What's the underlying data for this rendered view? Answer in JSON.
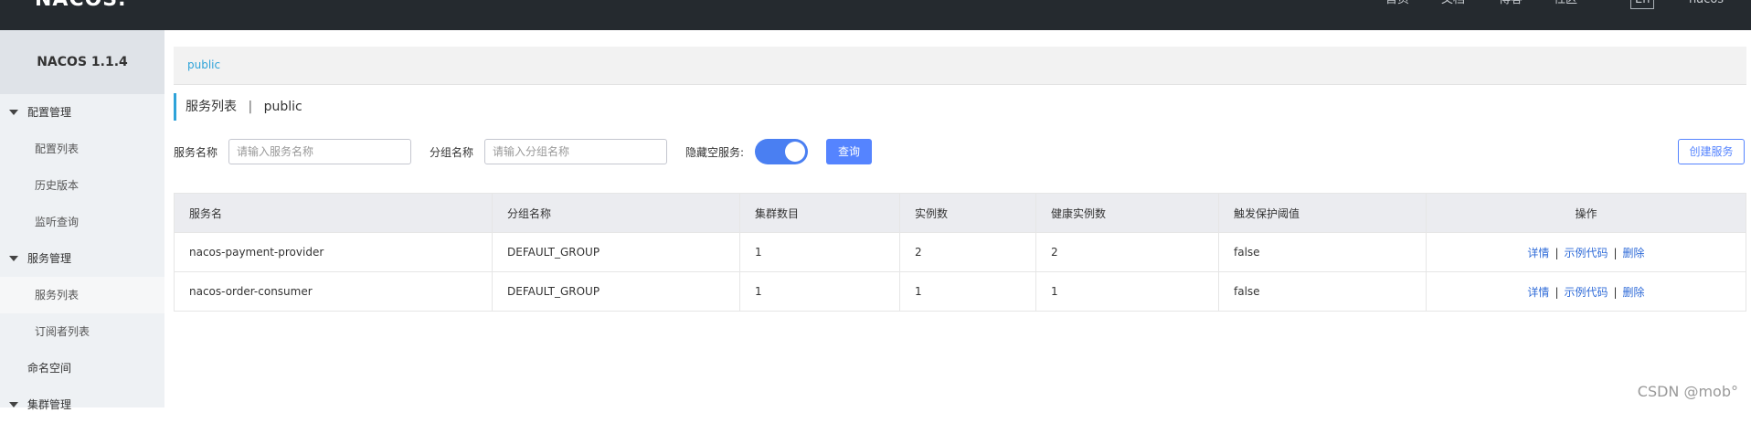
{
  "topbar": {
    "logo": "NACOS.",
    "nav": [
      "首页",
      "文档",
      "博客",
      "社区"
    ],
    "lang": "En",
    "user": "nacos"
  },
  "sidebar": {
    "title": "NACOS 1.1.4",
    "items": [
      {
        "label": "配置管理",
        "type": "group"
      },
      {
        "label": "配置列表",
        "type": "sub"
      },
      {
        "label": "历史版本",
        "type": "sub"
      },
      {
        "label": "监听查询",
        "type": "sub"
      },
      {
        "label": "服务管理",
        "type": "group"
      },
      {
        "label": "服务列表",
        "type": "sub",
        "active": true
      },
      {
        "label": "订阅者列表",
        "type": "sub"
      },
      {
        "label": "命名空间",
        "type": "plain"
      },
      {
        "label": "集群管理",
        "type": "group"
      }
    ]
  },
  "breadcrumb": {
    "namespace": "public"
  },
  "page": {
    "title": "服务列表",
    "separator": "|",
    "namespace": "public"
  },
  "filters": {
    "service_name_label": "服务名称",
    "service_name_placeholder": "请输入服务名称",
    "group_name_label": "分组名称",
    "group_name_placeholder": "请输入分组名称",
    "hide_empty_label": "隐藏空服务:",
    "hide_empty_on": true,
    "query_label": "查询",
    "create_label": "创建服务"
  },
  "table": {
    "headers": [
      "服务名",
      "分组名称",
      "集群数目",
      "实例数",
      "健康实例数",
      "触发保护阈值",
      "操作"
    ],
    "rows": [
      [
        "nacos-payment-provider",
        "DEFAULT_GROUP",
        "1",
        "2",
        "2",
        "false"
      ],
      [
        "nacos-order-consumer",
        "DEFAULT_GROUP",
        "1",
        "1",
        "1",
        "false"
      ]
    ],
    "ops": {
      "detail": "详情",
      "sample": "示例代码",
      "delete": "删除",
      "sep": "|"
    }
  },
  "watermark": "CSDN @mob°",
  "colors": {
    "topbar": "#252a2f",
    "accent": "#5584ff",
    "link": "#2ea3d9"
  }
}
